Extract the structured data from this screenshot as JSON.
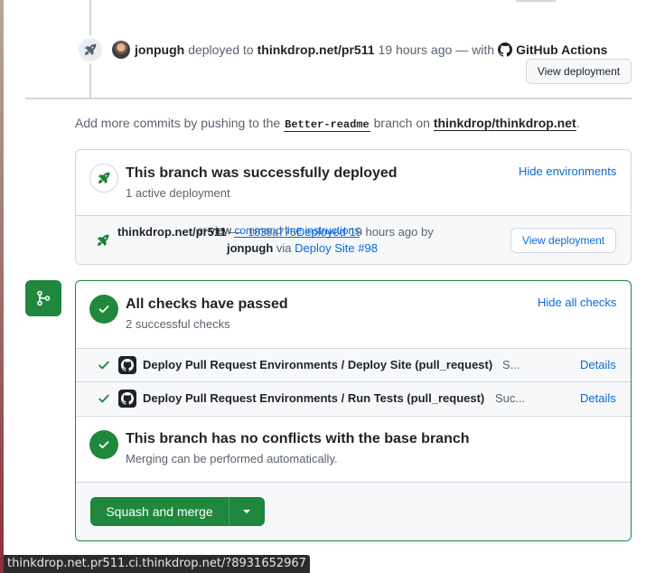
{
  "deploy_event": {
    "actor": "jonpugh",
    "action": "deployed to",
    "target": "thinkdrop.net/pr511",
    "time": "19 hours ago",
    "with_text": "— with",
    "app": "GitHub Actions",
    "view_button": "View deployment"
  },
  "hint": {
    "prefix": "Add more commits by pushing to the",
    "branch": "Better-readme",
    "middle": "branch on",
    "repo": "thinkdrop/thinkdrop.net",
    "suffix": "."
  },
  "deployments": {
    "title": "This branch was successfully deployed",
    "subtitle": "1 active deployment",
    "toggle_label": "Hide environments",
    "environment": {
      "name": "thinkdrop.net/pr511",
      "dash": "—",
      "sha": "1838a775",
      "status": "Deployed",
      "time": "19 hours ago by",
      "user": "jonpugh",
      "via": "via",
      "workflow": "Deploy Site #98",
      "button": "View deployment"
    }
  },
  "checks": {
    "title": "All checks have passed",
    "subtitle": "2 successful checks",
    "toggle_label": "Hide all checks",
    "items": [
      {
        "name": "Deploy Pull Request Environments / Deploy Site (pull_request)",
        "status": "S...",
        "details": "Details"
      },
      {
        "name": "Deploy Pull Request Environments / Run Tests (pull_request)",
        "status": "Suc...",
        "details": "Details"
      }
    ]
  },
  "conflicts": {
    "title": "This branch has no conflicts with the base branch",
    "subtitle": "Merging can be performed automatically."
  },
  "merge": {
    "button": "Squash and merge",
    "or_view": "or view",
    "cli_link": "command line instructions",
    "period": "."
  },
  "status_bar": {
    "url": "thinkdrop.net.pr511.ci.thinkdrop.net/?8931652967"
  },
  "colors": {
    "success": "#1f883d",
    "link": "#0969da",
    "muted": "#59636e",
    "border": "#d0d7de"
  },
  "icons": [
    "rocket-icon",
    "github-icon",
    "check-icon",
    "git-merge-icon",
    "triangle-down-icon"
  ]
}
